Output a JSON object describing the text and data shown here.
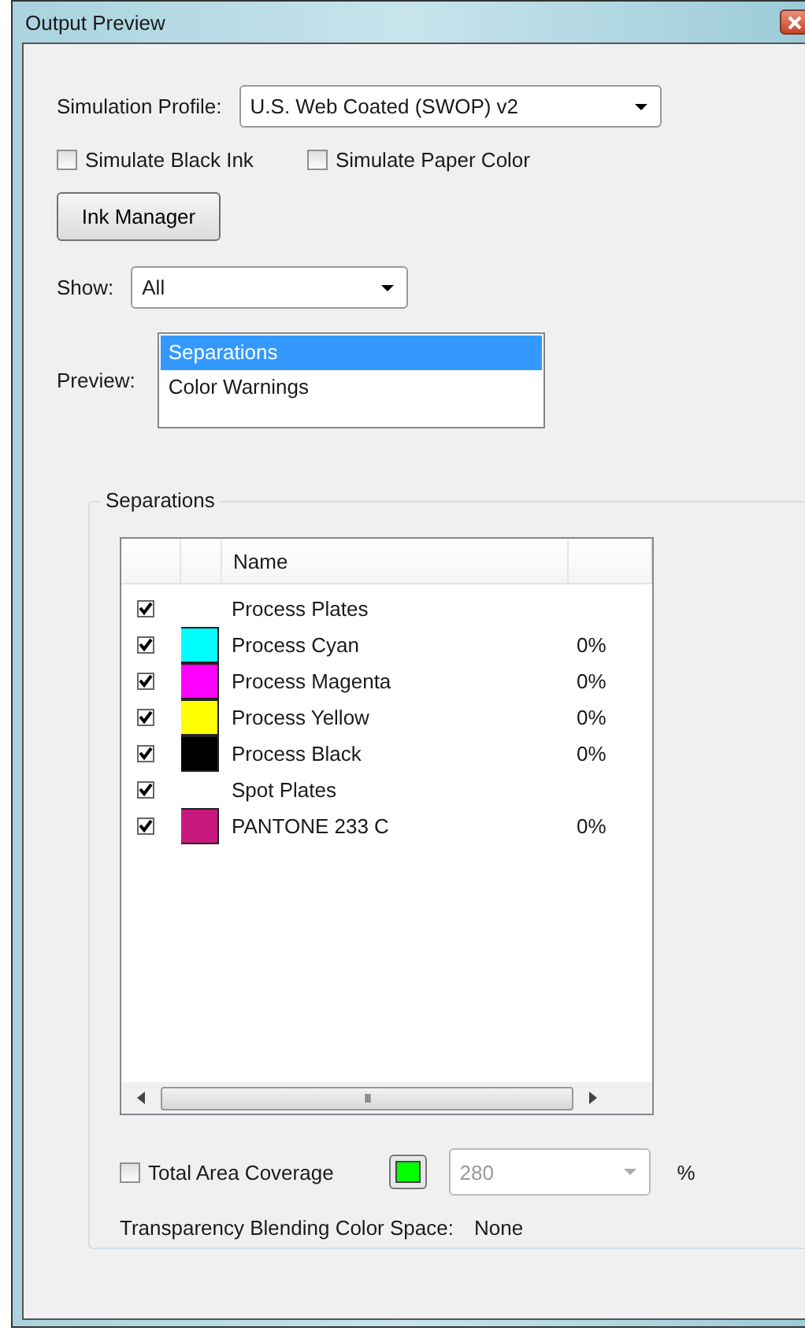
{
  "window": {
    "title": "Output Preview"
  },
  "simulation_profile": {
    "label": "Simulation Profile:",
    "value": "U.S. Web Coated (SWOP) v2"
  },
  "options": [
    {
      "label": "Simulate Black Ink",
      "checked": false
    },
    {
      "label": "Simulate Paper Color",
      "checked": false
    }
  ],
  "ink_manager_button": "Ink Manager",
  "show": {
    "label": "Show:",
    "value": "All"
  },
  "preview": {
    "label": "Preview:",
    "items": [
      {
        "label": "Separations",
        "selected": true
      },
      {
        "label": "Color Warnings",
        "selected": false
      }
    ]
  },
  "separations": {
    "title": "Separations",
    "columns": [
      "Name"
    ],
    "rows": [
      {
        "kind": "group",
        "name": "Process Plates",
        "checked": true
      },
      {
        "kind": "ink",
        "name": "Process Cyan",
        "color": "#00ffff",
        "coverage": "0%",
        "checked": true
      },
      {
        "kind": "ink",
        "name": "Process Magenta",
        "color": "#ff00ff",
        "coverage": "0%",
        "checked": true
      },
      {
        "kind": "ink",
        "name": "Process Yellow",
        "color": "#ffff00",
        "coverage": "0%",
        "checked": true
      },
      {
        "kind": "ink",
        "name": "Process Black",
        "color": "#000000",
        "coverage": "0%",
        "checked": true
      },
      {
        "kind": "group",
        "name": "Spot Plates",
        "checked": true
      },
      {
        "kind": "ink",
        "name": "PANTONE 233 C",
        "color": "#c8197e",
        "coverage": "0%",
        "checked": true
      }
    ],
    "scrollbar_grip": "III",
    "total_area_coverage": {
      "label": "Total Area Coverage",
      "checked": false,
      "color": "#00ff00",
      "value": "280",
      "unit": "%"
    },
    "blending": {
      "label": "Transparency Blending Color Space:",
      "value": "None"
    }
  }
}
